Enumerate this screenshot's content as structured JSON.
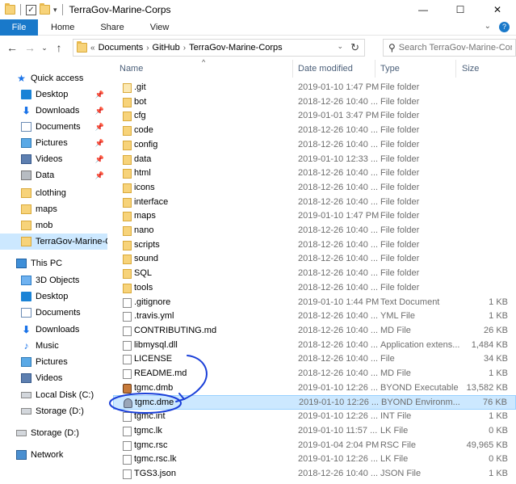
{
  "window": {
    "title": "TerraGov-Marine-Corps"
  },
  "window_buttons": [
    "—",
    "☐",
    "✕"
  ],
  "ribbon": {
    "tabs": [
      "File",
      "Home",
      "Share",
      "View"
    ]
  },
  "address": {
    "prefix": "«",
    "crumbs": [
      "Documents",
      "GitHub",
      "TerraGov-Marine-Corps"
    ]
  },
  "search": {
    "placeholder": "Search TerraGov-Marine-Corps"
  },
  "nav": {
    "quick_access": "Quick access",
    "pinned": [
      {
        "label": "Desktop",
        "icon": "desktop-icon"
      },
      {
        "label": "Downloads",
        "icon": "download-icon"
      },
      {
        "label": "Documents",
        "icon": "documents-icon"
      },
      {
        "label": "Pictures",
        "icon": "pictures-icon"
      },
      {
        "label": "Videos",
        "icon": "videos-icon"
      },
      {
        "label": "Data",
        "icon": "drive-icon"
      }
    ],
    "recent": [
      "clothing",
      "maps",
      "mob",
      "TerraGov-Marine-C"
    ],
    "this_pc": "This PC",
    "pc_items": [
      {
        "label": "3D Objects",
        "icon": "3d-objects-icon"
      },
      {
        "label": "Desktop",
        "icon": "desktop-icon"
      },
      {
        "label": "Documents",
        "icon": "documents-icon"
      },
      {
        "label": "Downloads",
        "icon": "download-icon"
      },
      {
        "label": "Music",
        "icon": "music-icon"
      },
      {
        "label": "Pictures",
        "icon": "pictures-icon"
      },
      {
        "label": "Videos",
        "icon": "videos-icon"
      },
      {
        "label": "Local Disk (C:)",
        "icon": "disk-icon"
      },
      {
        "label": "Storage (D:)",
        "icon": "disk-icon"
      }
    ],
    "storage": "Storage (D:)",
    "network": "Network"
  },
  "columns": {
    "name": "Name",
    "date": "Date modified",
    "type": "Type",
    "size": "Size"
  },
  "files": [
    {
      "name": ".git",
      "date": "2019-01-10 1:47 PM",
      "type": "File folder",
      "size": "",
      "kind": "folder-light"
    },
    {
      "name": "bot",
      "date": "2018-12-26 10:40 ...",
      "type": "File folder",
      "size": "",
      "kind": "folder"
    },
    {
      "name": "cfg",
      "date": "2019-01-01 3:47 PM",
      "type": "File folder",
      "size": "",
      "kind": "folder"
    },
    {
      "name": "code",
      "date": "2018-12-26 10:40 ...",
      "type": "File folder",
      "size": "",
      "kind": "folder"
    },
    {
      "name": "config",
      "date": "2018-12-26 10:40 ...",
      "type": "File folder",
      "size": "",
      "kind": "folder"
    },
    {
      "name": "data",
      "date": "2019-01-10 12:33 ...",
      "type": "File folder",
      "size": "",
      "kind": "folder"
    },
    {
      "name": "html",
      "date": "2018-12-26 10:40 ...",
      "type": "File folder",
      "size": "",
      "kind": "folder"
    },
    {
      "name": "icons",
      "date": "2018-12-26 10:40 ...",
      "type": "File folder",
      "size": "",
      "kind": "folder"
    },
    {
      "name": "interface",
      "date": "2018-12-26 10:40 ...",
      "type": "File folder",
      "size": "",
      "kind": "folder"
    },
    {
      "name": "maps",
      "date": "2019-01-10 1:47 PM",
      "type": "File folder",
      "size": "",
      "kind": "folder"
    },
    {
      "name": "nano",
      "date": "2018-12-26 10:40 ...",
      "type": "File folder",
      "size": "",
      "kind": "folder"
    },
    {
      "name": "scripts",
      "date": "2018-12-26 10:40 ...",
      "type": "File folder",
      "size": "",
      "kind": "folder"
    },
    {
      "name": "sound",
      "date": "2018-12-26 10:40 ...",
      "type": "File folder",
      "size": "",
      "kind": "folder"
    },
    {
      "name": "SQL",
      "date": "2018-12-26 10:40 ...",
      "type": "File folder",
      "size": "",
      "kind": "folder"
    },
    {
      "name": "tools",
      "date": "2018-12-26 10:40 ...",
      "type": "File folder",
      "size": "",
      "kind": "folder"
    },
    {
      "name": ".gitignore",
      "date": "2019-01-10 1:44 PM",
      "type": "Text Document",
      "size": "1 KB",
      "kind": "file"
    },
    {
      "name": ".travis.yml",
      "date": "2018-12-26 10:40 ...",
      "type": "YML File",
      "size": "1 KB",
      "kind": "file"
    },
    {
      "name": "CONTRIBUTING.md",
      "date": "2018-12-26 10:40 ...",
      "type": "MD File",
      "size": "26 KB",
      "kind": "file"
    },
    {
      "name": "libmysql.dll",
      "date": "2018-12-26 10:40 ...",
      "type": "Application extens...",
      "size": "1,484 KB",
      "kind": "gear"
    },
    {
      "name": "LICENSE",
      "date": "2018-12-26 10:40 ...",
      "type": "File",
      "size": "34 KB",
      "kind": "file"
    },
    {
      "name": "README.md",
      "date": "2018-12-26 10:40 ...",
      "type": "MD File",
      "size": "1 KB",
      "kind": "file"
    },
    {
      "name": "tgmc.dmb",
      "date": "2019-01-10 12:26 ...",
      "type": "BYOND Executable",
      "size": "13,582 KB",
      "kind": "byond"
    },
    {
      "name": "tgmc.dme",
      "date": "2019-01-10 12:26 ...",
      "type": "BYOND Environm...",
      "size": "76 KB",
      "kind": "byond2",
      "selected": true
    },
    {
      "name": "tgmc.int",
      "date": "2019-01-10 12:26 ...",
      "type": "INT File",
      "size": "1 KB",
      "kind": "file"
    },
    {
      "name": "tgmc.lk",
      "date": "2019-01-10 11:57 ...",
      "type": "LK File",
      "size": "0 KB",
      "kind": "file"
    },
    {
      "name": "tgmc.rsc",
      "date": "2019-01-04 2:04 PM",
      "type": "RSC File",
      "size": "49,965 KB",
      "kind": "file"
    },
    {
      "name": "tgmc.rsc.lk",
      "date": "2019-01-10 12:26 ...",
      "type": "LK File",
      "size": "0 KB",
      "kind": "file"
    },
    {
      "name": "TGS3.json",
      "date": "2018-12-26 10:40 ...",
      "type": "JSON File",
      "size": "1 KB",
      "kind": "file"
    }
  ],
  "colors": {
    "accent": "#1979ca",
    "selection": "#cce8ff",
    "annotation": "#1a3fd8"
  }
}
